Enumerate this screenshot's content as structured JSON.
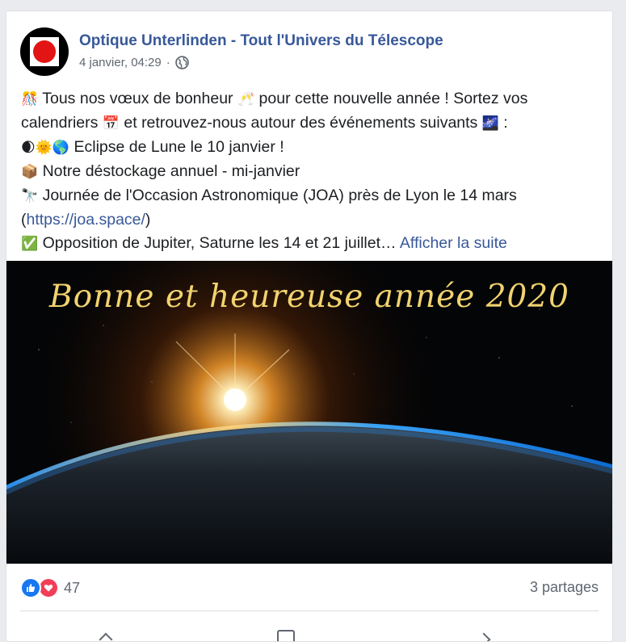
{
  "post": {
    "page_name": "Optique Unterlinden - Tout l'Univers du Télescope",
    "timestamp": "4 janvier, 04:29",
    "separator": "·",
    "privacy_icon": "globe-icon",
    "lines": [
      {
        "emoji": "🎊",
        "text": " Tous nos vœux de bonheur ",
        "emoji2": "🥂",
        "text2": " pour cette nouvelle année ! Sortez vos"
      },
      {
        "text": "calendriers ",
        "emoji": "📅",
        "text2": " et retrouvez-nous autour des événements suivants ",
        "emoji2": "🌌",
        "text3": " :"
      },
      {
        "emoji": "🌒🌞🌎",
        "text": " Eclipse de Lune le 10 janvier !"
      },
      {
        "emoji": "📦",
        "text": " Notre déstockage annuel - mi-janvier"
      },
      {
        "emoji": "🔭",
        "text": " Journée de l'Occasion Astronomique (JOA) près de Lyon le 14 mars"
      },
      {
        "pre": "(",
        "link": "https://joa.space/",
        "post": ")"
      },
      {
        "emoji": "✅",
        "text": " Opposition de Jupiter, Saturne les 14 et 21 juillet… ",
        "more": "Afficher la suite"
      }
    ],
    "image": {
      "title": "Bonne et heureuse année 2020",
      "title_color": "#f2d36f"
    }
  },
  "footer": {
    "reaction_icons": [
      "like-icon",
      "love-icon"
    ],
    "reaction_count": "47",
    "shares": "3 partages"
  },
  "colors": {
    "link": "#385898",
    "text": "#1c1e21",
    "secondary": "#606770",
    "like": "#1877f2",
    "love": "#f33e58"
  }
}
